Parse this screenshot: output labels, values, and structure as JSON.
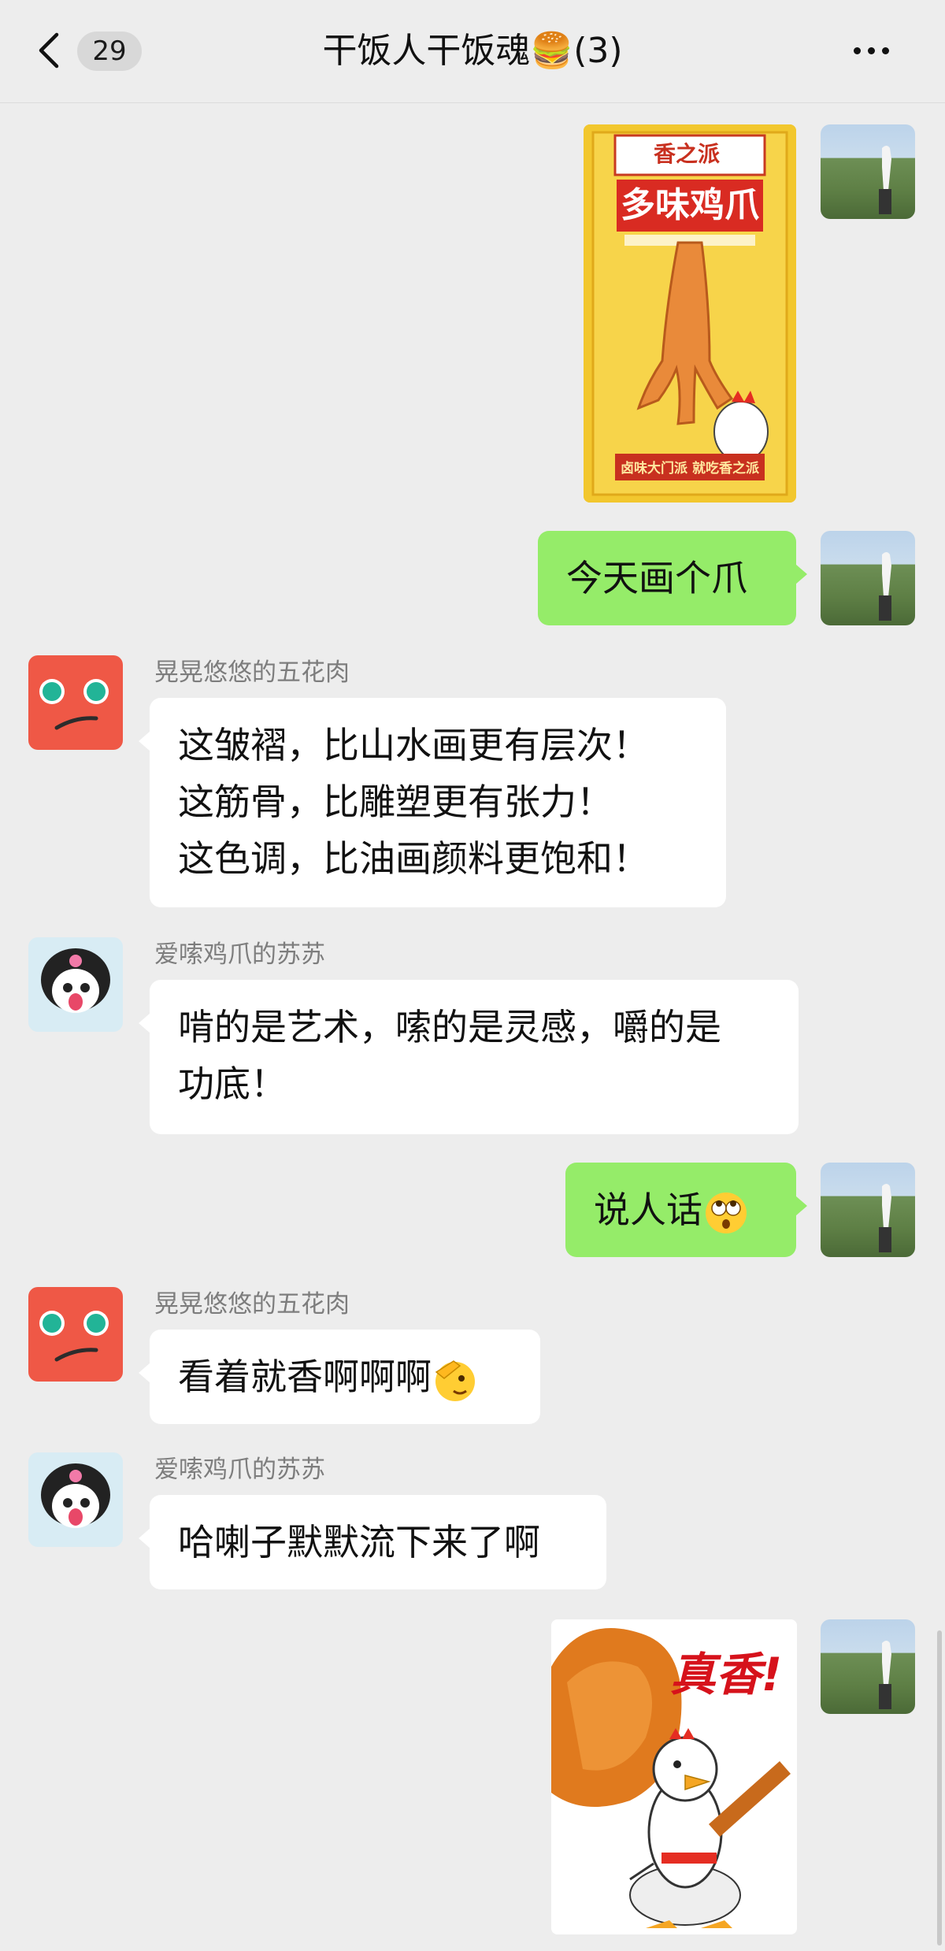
{
  "header": {
    "unread_count": "29",
    "title": "干饭人干饭魂🍔(3)"
  },
  "messages": [
    {
      "side": "right",
      "type": "image",
      "image_text": {
        "brand": "香之派",
        "product": "多味鸡爪",
        "slogan": "卤味大门派 就吃香之派"
      }
    },
    {
      "side": "right",
      "type": "text",
      "text": "今天画个爪"
    },
    {
      "side": "left",
      "type": "text",
      "sender": "晃晃悠悠的五花肉",
      "lines": [
        "这皱褶，比山水画更有层次！",
        "这筋骨，比雕塑更有张力！",
        "这色调，比油画颜料更饱和！"
      ]
    },
    {
      "side": "left",
      "type": "text",
      "sender": "爱嗦鸡爪的苏苏",
      "lines": [
        "啃的是艺术，嗦的是灵感，嚼的是",
        "功底！"
      ]
    },
    {
      "side": "right",
      "type": "text",
      "text": "说人话",
      "emoji": "eyes-rolling-emoji"
    },
    {
      "side": "left",
      "type": "text",
      "sender": "晃晃悠悠的五花肉",
      "text": "看着就香啊啊啊",
      "emoji": "salute-emoji"
    },
    {
      "side": "left",
      "type": "text",
      "sender": "爱嗦鸡爪的苏苏",
      "text": "哈喇子默默流下来了啊"
    },
    {
      "side": "right",
      "type": "image",
      "image_text": {
        "caption": "真香!"
      }
    }
  ],
  "colors": {
    "green_bubble": "#95ec69",
    "white_bubble": "#ffffff",
    "background": "#ededed"
  }
}
